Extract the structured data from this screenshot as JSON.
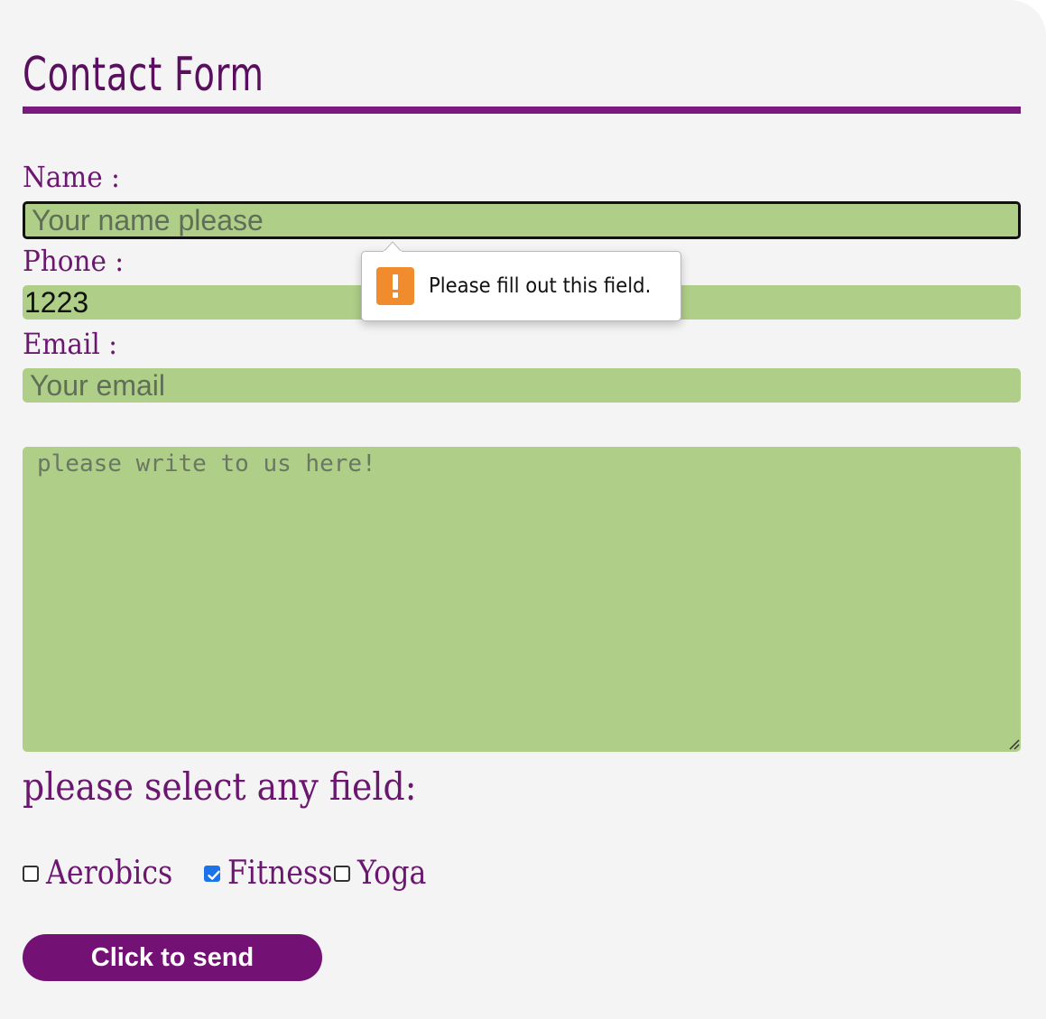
{
  "form": {
    "title": "Contact Form",
    "name_label": "Name :",
    "name_placeholder": "Your name please",
    "phone_label": "Phone :",
    "phone_value": "1223",
    "email_label": "Email :",
    "email_placeholder": "Your email",
    "message_placeholder": "please write to us here!",
    "select_label": "please select any field:",
    "options": [
      {
        "label": "Aerobics",
        "checked": false
      },
      {
        "label": "Fitness",
        "checked": true
      },
      {
        "label": "Yoga",
        "checked": false
      }
    ],
    "submit_label": "Click to send"
  },
  "validation": {
    "message": "Please fill out this field.",
    "icon": "warning-icon"
  },
  "colors": {
    "accent": "#741174",
    "heading": "#5a0f5e",
    "field_bg": "#afce87",
    "background": "#f4f4f4",
    "warning": "#f08c2e",
    "checkbox_checked": "#1a73e8"
  }
}
